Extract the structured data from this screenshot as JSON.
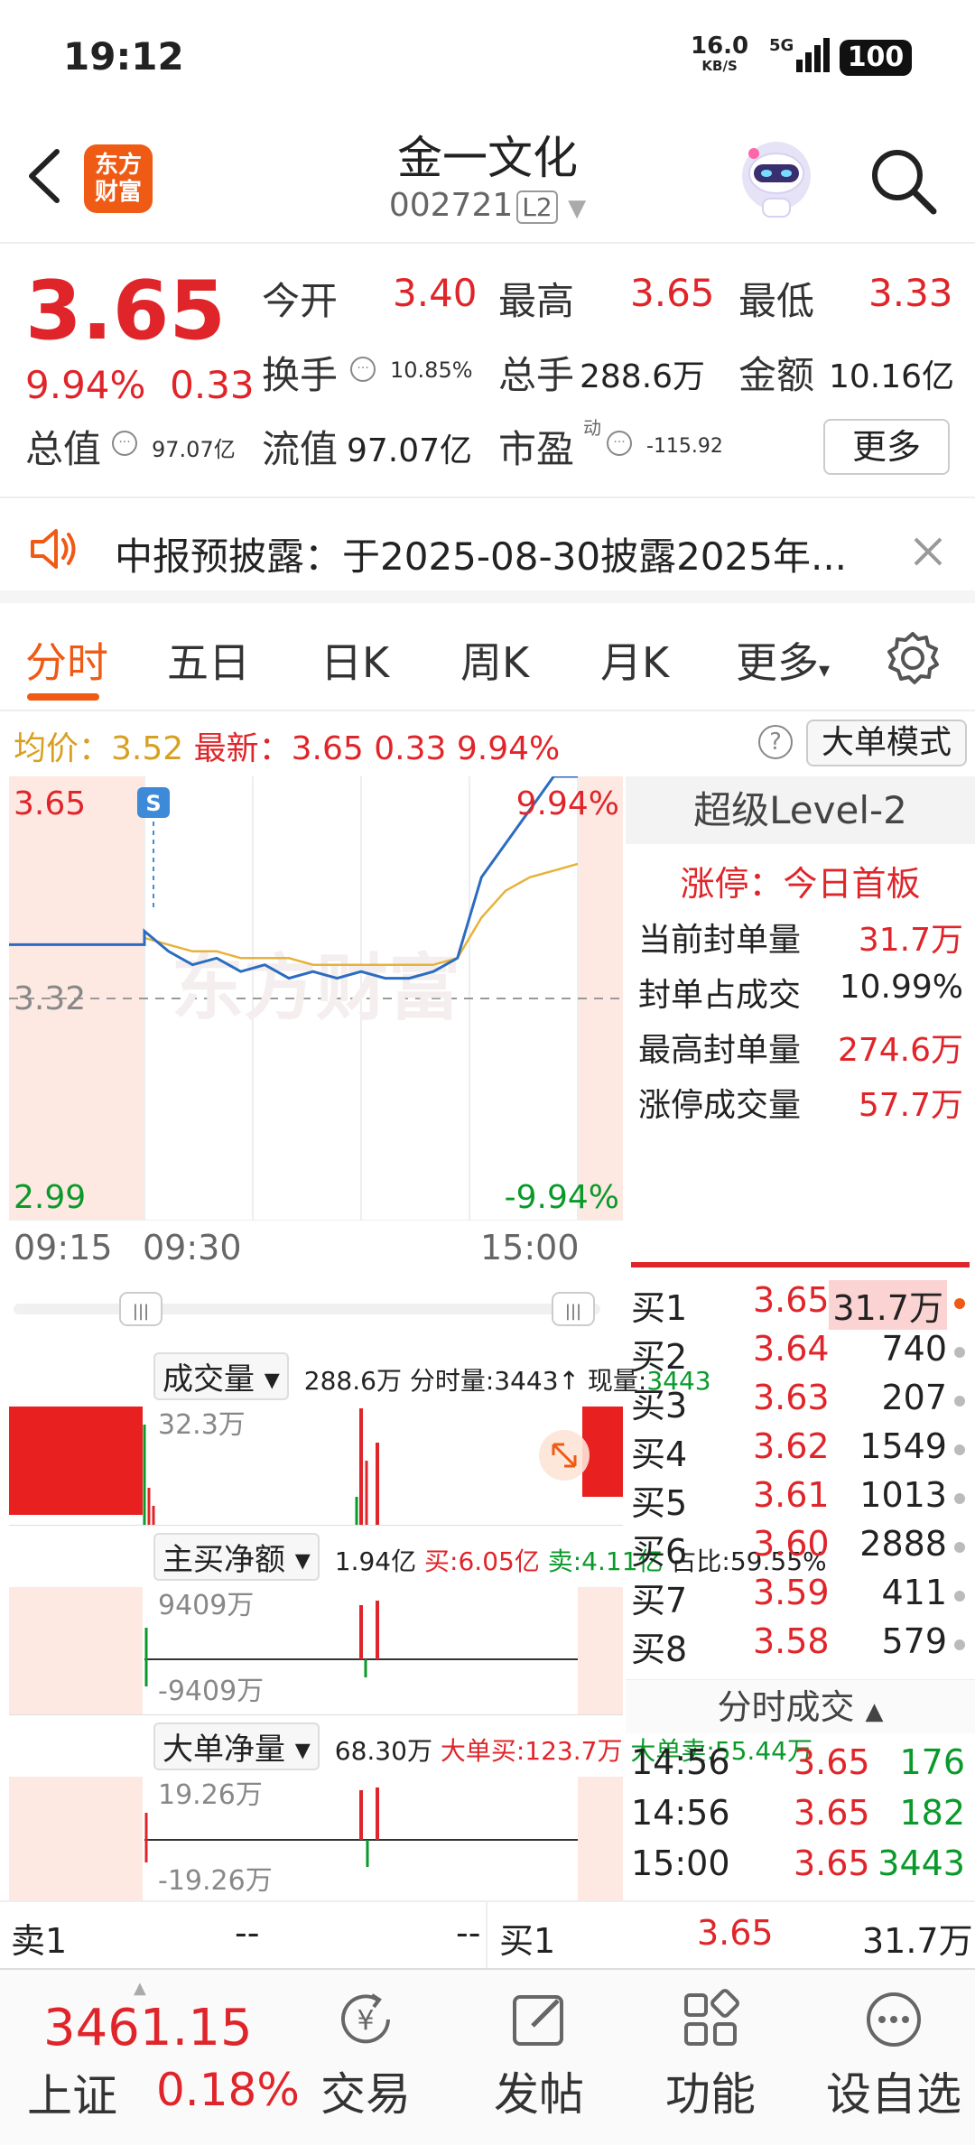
{
  "status": {
    "time": "19:12",
    "net_speed": "16.0",
    "net_unit": "KB/S",
    "network": "5G",
    "battery": "100"
  },
  "header": {
    "title": "金一文化",
    "code": "002721",
    "level_badge": "L2",
    "logo_line1": "东方",
    "logo_line2": "财富"
  },
  "quote": {
    "price": "3.65",
    "change_pct": "9.94%",
    "change": "0.33",
    "open_label": "今开",
    "open": "3.40",
    "high_label": "最高",
    "high": "3.65",
    "low_label": "最低",
    "low": "3.33",
    "turnover_label": "换手",
    "turnover": "10.85%",
    "volume_label": "总手",
    "volume": "288.6万",
    "amount_label": "金额",
    "amount": "10.16亿",
    "mktcap_label": "总值",
    "mktcap": "97.07亿",
    "float_label": "流值",
    "float": "97.07亿",
    "pe_label": "市盈",
    "pe_sup": "动",
    "pe": "-115.92",
    "more_label": "更多"
  },
  "notice": {
    "text": "中报预披露：于2025-08-30披露2025年..."
  },
  "tabs": [
    {
      "label": "分时"
    },
    {
      "label": "五日"
    },
    {
      "label": "日K"
    },
    {
      "label": "周K"
    },
    {
      "label": "月K"
    },
    {
      "label": "更多"
    }
  ],
  "info_row": {
    "avg_label": "均价：",
    "avg": "3.52",
    "latest_label": "最新：",
    "latest": "3.65",
    "latest_change": "0.33",
    "latest_pct": "9.94%",
    "mode_button": "大单模式"
  },
  "chart": {
    "y_top": "3.65",
    "y_mid": "3.32",
    "y_bottom": "2.99",
    "pct_top": "9.94%",
    "pct_bottom": "-9.94%",
    "x_labels": [
      "09:15",
      "09:30",
      "15:00"
    ],
    "signal_badge": "S",
    "watermark": "东方财富"
  },
  "chart_data": {
    "type": "line",
    "ylim": [
      2.99,
      3.65
    ],
    "series": [
      {
        "values": [
          3.4,
          3.4,
          3.4,
          3.42,
          3.39,
          3.37,
          3.38,
          3.36,
          3.37,
          3.35,
          3.36,
          3.35,
          3.36,
          3.35,
          3.35,
          3.36,
          3.38,
          3.5,
          3.55,
          3.6,
          3.65,
          3.65
        ]
      },
      {
        "values": [
          3.4,
          3.4,
          3.4,
          3.41,
          3.4,
          3.39,
          3.39,
          3.38,
          3.38,
          3.38,
          3.37,
          3.37,
          3.37,
          3.37,
          3.37,
          3.37,
          3.38,
          3.44,
          3.48,
          3.5,
          3.51,
          3.52
        ]
      }
    ]
  },
  "volume_panel": {
    "dropdown": "成交量",
    "total": "288.6万",
    "per_min_label": "分时量:",
    "per_min": "3443↑",
    "now_label": "现量:",
    "now": "3443",
    "axis_max": "32.3万"
  },
  "netbuy_panel": {
    "dropdown": "主买净额",
    "value": "1.94亿",
    "buy": "买:6.05亿",
    "sell": "卖:4.11亿",
    "ratio": "占比:59.55%",
    "axis_max": "9409万",
    "axis_min": "-9409万"
  },
  "bigorder_panel": {
    "dropdown": "大单净量",
    "value": "68.30万",
    "buy": "大单买:123.7万",
    "sell": "大单卖:55.44万",
    "axis_max": "19.26万",
    "axis_min": "-19.26万"
  },
  "level2": {
    "title": "超级Level-2",
    "limit_status": "涨停：今日首板",
    "rows": [
      {
        "label": "当前封单量",
        "value": "31.7万"
      },
      {
        "label": "封单占成交",
        "value": "10.99%"
      },
      {
        "label": "最高封单量",
        "value": "274.6万"
      },
      {
        "label": "涨停成交量",
        "value": "57.7万"
      }
    ]
  },
  "bids": [
    {
      "label": "买1",
      "price": "3.65",
      "qty": "31.7万"
    },
    {
      "label": "买2",
      "price": "3.64",
      "qty": "740"
    },
    {
      "label": "买3",
      "price": "3.63",
      "qty": "207"
    },
    {
      "label": "买4",
      "price": "3.62",
      "qty": "1549"
    },
    {
      "label": "买5",
      "price": "3.61",
      "qty": "1013"
    },
    {
      "label": "买6",
      "price": "3.60",
      "qty": "2888"
    },
    {
      "label": "买7",
      "price": "3.59",
      "qty": "411"
    },
    {
      "label": "买8",
      "price": "3.58",
      "qty": "579"
    }
  ],
  "ticks": {
    "title": "分时成交",
    "rows": [
      {
        "time": "14:56",
        "price": "3.65",
        "qty": "176"
      },
      {
        "time": "14:56",
        "price": "3.65",
        "qty": "182"
      },
      {
        "time": "15:00",
        "price": "3.65",
        "qty": "3443"
      }
    ]
  },
  "ask_bid": {
    "ask_label": "卖1",
    "ask_price": "--",
    "ask_qty": "--",
    "bid_label": "买1",
    "bid_price": "3.65",
    "bid_qty": "31.7万"
  },
  "bottom_nav": {
    "index_value": "3461.15",
    "index_name": "上证",
    "index_pct": "0.18%",
    "items": [
      {
        "label": "交易"
      },
      {
        "label": "发帖"
      },
      {
        "label": "功能"
      },
      {
        "label": "设自选"
      }
    ]
  }
}
